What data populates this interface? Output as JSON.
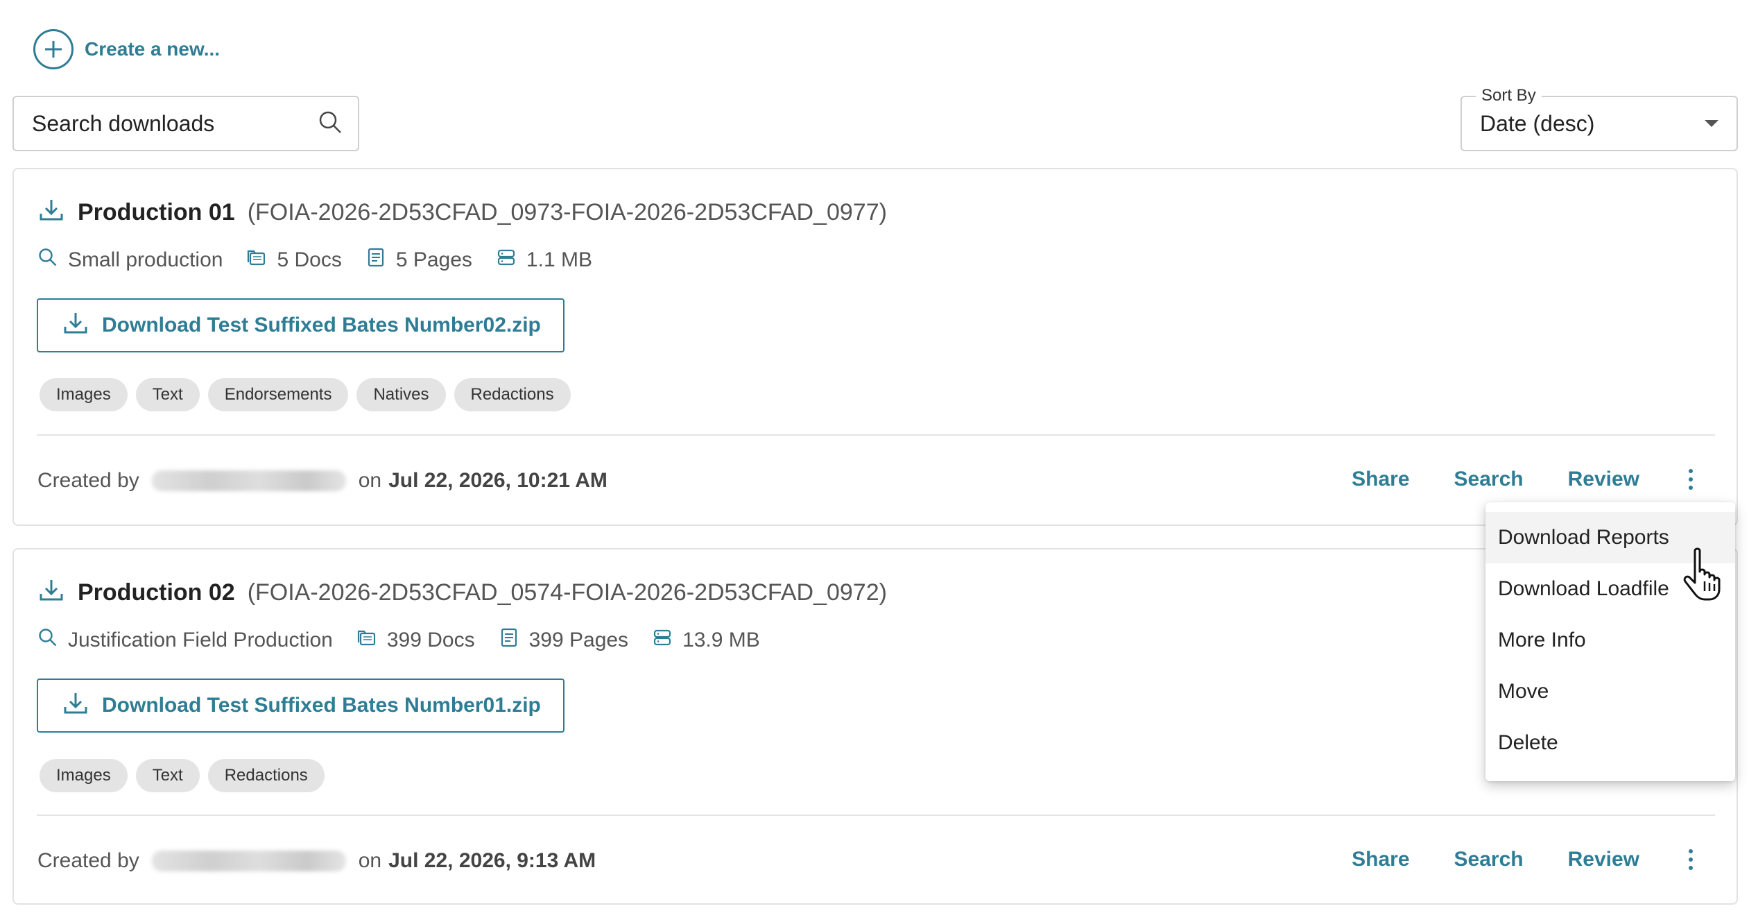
{
  "create_new": {
    "label": "Create a new..."
  },
  "search": {
    "placeholder": "Search downloads"
  },
  "sort": {
    "legend": "Sort By",
    "value": "Date (desc)"
  },
  "productions": [
    {
      "name": "Production 01",
      "range": "(FOIA-2026-2D53CFAD_0973-FOIA-2026-2D53CFAD_0977)",
      "description": "Small production",
      "docs": "5 Docs",
      "pages": "5 Pages",
      "size": "1.1 MB",
      "download_label": "Download Test Suffixed Bates Number02.zip",
      "chips": [
        "Images",
        "Text",
        "Endorsements",
        "Natives",
        "Redactions"
      ],
      "created_prefix": "Created by",
      "created_on": "on",
      "created_date": "Jul 22, 2026, 10:21 AM"
    },
    {
      "name": "Production 02",
      "range": "(FOIA-2026-2D53CFAD_0574-FOIA-2026-2D53CFAD_0972)",
      "description": "Justification Field Production",
      "docs": "399 Docs",
      "pages": "399 Pages",
      "size": "13.9 MB",
      "download_label": "Download Test Suffixed Bates Number01.zip",
      "chips": [
        "Images",
        "Text",
        "Redactions"
      ],
      "created_prefix": "Created by",
      "created_on": "on",
      "created_date": "Jul 22, 2026, 9:13 AM"
    }
  ],
  "actions": {
    "share": "Share",
    "search": "Search",
    "review": "Review"
  },
  "menu": {
    "items": [
      "Download Reports",
      "Download Loadfile",
      "More Info",
      "Move",
      "Delete"
    ],
    "hovered": "Download Reports"
  },
  "colors": {
    "accent": "#2e7d95",
    "chip_bg": "#e4e4e4",
    "border": "#e2e2e2"
  },
  "icons": {
    "create": "plus-circle-icon",
    "search": "search-icon",
    "sort": "caret-down-icon",
    "production": "download-icon",
    "description": "search-icon",
    "docs": "folders-icon",
    "pages": "document-icon",
    "size": "storage-icon",
    "more": "kebab-icon",
    "cursor": "hand-pointer-icon"
  }
}
